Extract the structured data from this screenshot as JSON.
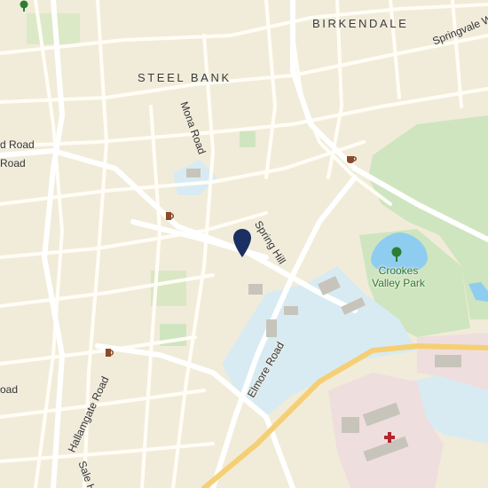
{
  "map": {
    "areas": {
      "birkendale": "BIRKENDALE",
      "steel_bank": "STEEL BANK"
    },
    "roads": {
      "springvale": "Springvale W",
      "mona_road": "Mona Road",
      "road_1": "d Road",
      "road_2": "Road",
      "spring_hill": "Spring Hill",
      "elmore_road": "Elmore Road",
      "hallamgate_road": "Hallamgate Road",
      "sale_hill": "Sale Hill",
      "left_oad": "oad"
    },
    "parks": {
      "crookes_valley_park": "Crookes Valley Park"
    },
    "icons": [
      "cafe-icon",
      "pub-icon",
      "tree-icon",
      "hospital-icon",
      "location-pin-icon"
    ],
    "colors": {
      "land": "#f1ecd9",
      "park": "#cfe5c0",
      "water": "#8ecdf0",
      "campus": "#d8ebf3",
      "hospital_area": "#efdede",
      "main_road": "#f6cf74",
      "pin": "#1b2f63",
      "poi": "#8a4a2c"
    }
  }
}
